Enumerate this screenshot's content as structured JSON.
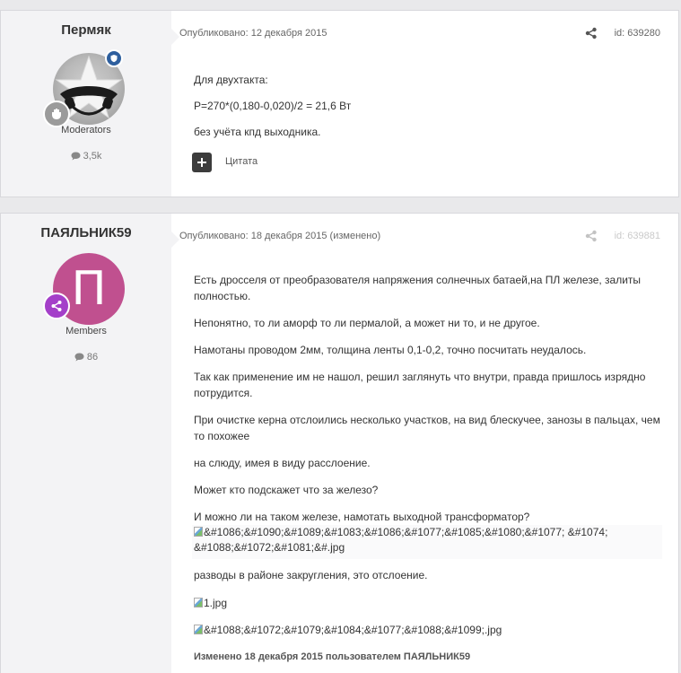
{
  "posts": [
    {
      "author": "Пермяк",
      "group": "Moderators",
      "post_count": "3,5k",
      "published": "Опубликовано: 12 декабря 2015",
      "id_label": "id: 639280",
      "lines": [
        "Для двухтакта:",
        "P=270*(0,180-0,020)/2 = 21,6 Вт",
        "без учёта кпд выходника."
      ],
      "quote_label": "Цитата"
    },
    {
      "author": "ПАЯЛЬНИК59",
      "avatar_letter": "П",
      "group": "Members",
      "post_count": "86",
      "published": "Опубликовано: 18 декабря 2015 (изменено)",
      "id_label": "id: 639881",
      "lines": [
        "Есть дросселя от преобразователя напряжения солнечных батаей,на ПЛ железе, залиты полностью.",
        "Непонятно, то ли аморф то ли пермалой, а может ни то, и не другое.",
        "Намотаны проводом 2мм, толщина ленты 0,1-0,2, точно посчитать неудалось.",
        "Так как применение им не нашол, решил заглянуть что внутри, правда пришлось изрядно потрудится.",
        "При очистке керна отслоились несколько участков, на вид блескучее, занозы в пальцах, чем то похожее",
        "на слюду, имея в виду расслоение.",
        "Может кто подскажет что за железо?",
        "И можно ли на таком железе, намотать выходной трансформатор?"
      ],
      "image1_alt_a": "&#1086;&#1090;&#1089;&#1083;&#1086;&#1077;&#1085;&#1080;&#1077; &#1074;",
      "image1_alt_b": "&#1088;&#1072;&#1081;&#.jpg",
      "caption": "разводы в районе закругления, это отслоение.",
      "image2_alt": "1.jpg",
      "image3_alt": "&#1088;&#1072;&#1079;&#1084;&#1077;&#1088;&#1099;.jpg",
      "edited_note": "Изменено 18 декабря 2015 пользователем ПАЯЛЬНИК59"
    }
  ]
}
